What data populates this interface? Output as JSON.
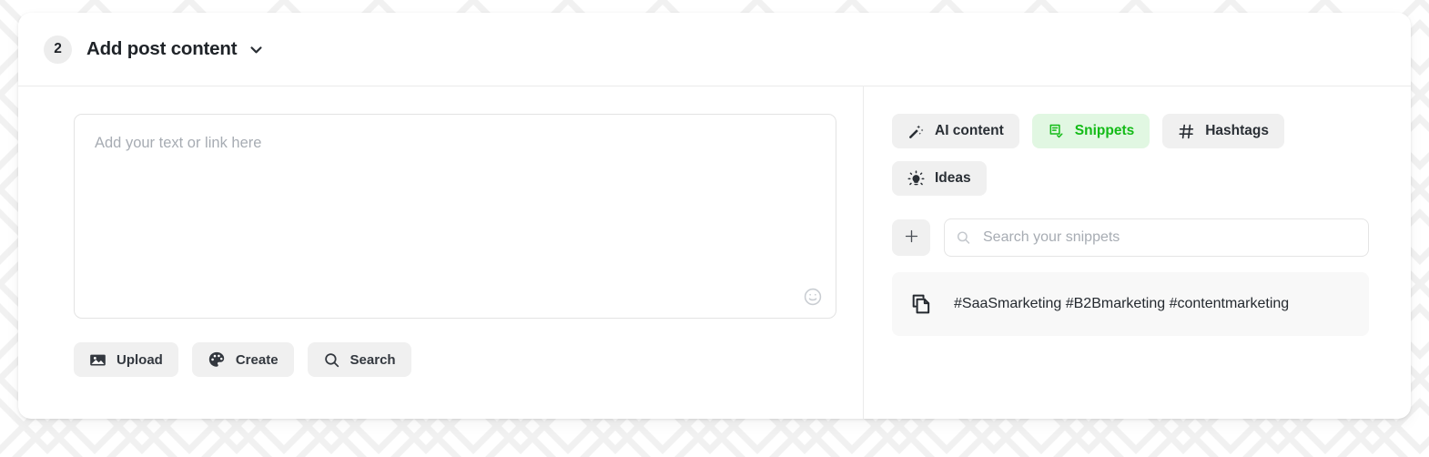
{
  "background": {
    "pattern_name": "geometric-star-lattice",
    "pattern_color": "#f2f2f2",
    "page_color": "#ffffff"
  },
  "card": {
    "background": "#ffffff",
    "header": {
      "step_number": "2",
      "title": "Add post content",
      "collapse_icon": "chevron-down-icon"
    }
  },
  "composer": {
    "placeholder": "Add your text or link here",
    "value": "",
    "emoji_icon": "smiley-face-icon"
  },
  "media_actions": [
    {
      "label": "Upload",
      "icon": "image-icon"
    },
    {
      "label": "Create",
      "icon": "palette-icon"
    },
    {
      "label": "Search",
      "icon": "search-icon"
    }
  ],
  "tools": {
    "tabs": [
      {
        "label": "AI content",
        "icon": "magic-wand-icon",
        "active": false
      },
      {
        "label": "Snippets",
        "icon": "document-check-icon",
        "active": true
      },
      {
        "label": "Hashtags",
        "icon": "hashtag-icon",
        "active": false
      },
      {
        "label": "Ideas",
        "icon": "lightbulb-icon",
        "active": false
      }
    ],
    "active_color": "#13bb17",
    "active_background": "#e1f7e2",
    "inactive_background": "#f0f0f0"
  },
  "snippets_panel": {
    "add_button_icon": "plus-icon",
    "search": {
      "placeholder": "Search your snippets",
      "value": "",
      "icon": "search-icon"
    },
    "items": [
      {
        "icon": "copy-icon",
        "text": "#SaaSmarketing #B2Bmarketing #contentmarketing"
      }
    ]
  }
}
